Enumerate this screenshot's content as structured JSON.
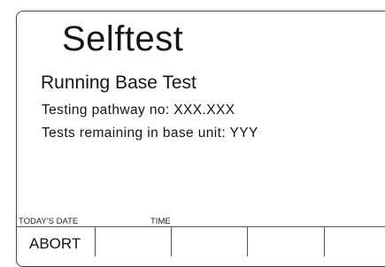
{
  "screen": {
    "title": "Selftest",
    "subtitle": "Running Base Test",
    "pathway_line": "Testing pathway no:  XXX.XXX",
    "remaining_line": "Tests remaining in base unit:  YYY"
  },
  "footer": {
    "date_label": "TODAY'S DATE",
    "time_label": "TIME"
  },
  "softkeys": [
    "ABORT",
    "",
    "",
    "",
    ""
  ]
}
